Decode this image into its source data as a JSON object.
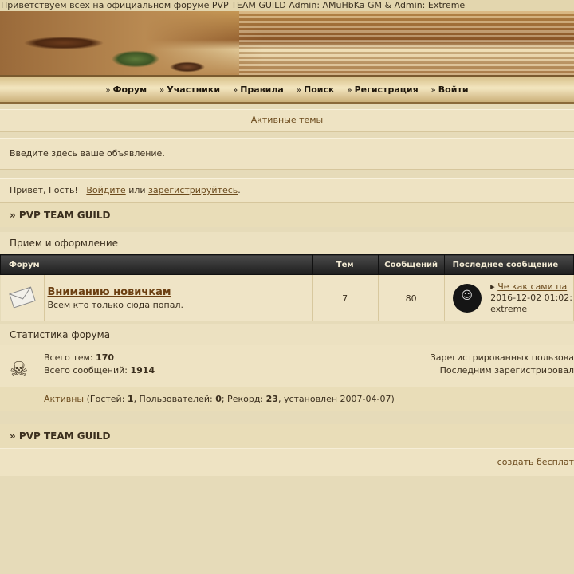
{
  "header": {
    "welcome_line": "Приветствуем всех на официальном форуме PVP TEAM GUILD Admin: AMuHbKa GM & Admin: Extreme"
  },
  "nav": [
    {
      "label": "Форум",
      "icon": "double-chevron-right"
    },
    {
      "label": "Участники",
      "icon": "double-chevron-right"
    },
    {
      "label": "Правила",
      "icon": "double-chevron-right"
    },
    {
      "label": "Поиск",
      "icon": "double-chevron-right"
    },
    {
      "label": "Регистрация",
      "icon": "double-chevron-right"
    },
    {
      "label": "Войти",
      "icon": "double-chevron-right"
    }
  ],
  "active_topics_link": "Активные темы",
  "announcement": "Введите здесь ваше объявление.",
  "welcome": {
    "greeting": "Привет, Гость!",
    "login_link": "Войдите",
    "or": "или",
    "register_link": "зарегистрируйтесь",
    "period": "."
  },
  "breadcrumb": "» PVP TEAM GUILD",
  "category": "Прием и оформление",
  "forum_table": {
    "headers": {
      "forum": "Форум",
      "topics": "Тем",
      "posts": "Сообщений",
      "last_post": "Последнее сообщение"
    },
    "rows": [
      {
        "title": "Вниманию новичкам",
        "description": "Всем кто только сюда попал.",
        "topics": "7",
        "posts": "80",
        "last_topic": "Че как сами па",
        "last_date": "2016-12-02 01:02:",
        "last_author": "extreme"
      }
    ]
  },
  "stats": {
    "title": "Статистика форума",
    "topics_label": "Всего тем:",
    "topics_value": "170",
    "posts_label": "Всего сообщений:",
    "posts_value": "1914",
    "registered": "Зарегистрированных пользова",
    "last_registered": "Последним зарегистрировал",
    "active_link": "Активны",
    "active_open": " (Гостей: ",
    "guests": "1",
    "users_label": ", Пользователей: ",
    "users": "0",
    "record_label": "; Рекорд: ",
    "record": "23",
    "record_date": ", установлен 2007-04-07)"
  },
  "footer_breadcrumb": "» PVP TEAM GUILD",
  "footer_link": "создать бесплат",
  "colors": {
    "background": "#e6dbb9",
    "link": "#6b4a1c",
    "table_header": "#1e1e1e"
  }
}
